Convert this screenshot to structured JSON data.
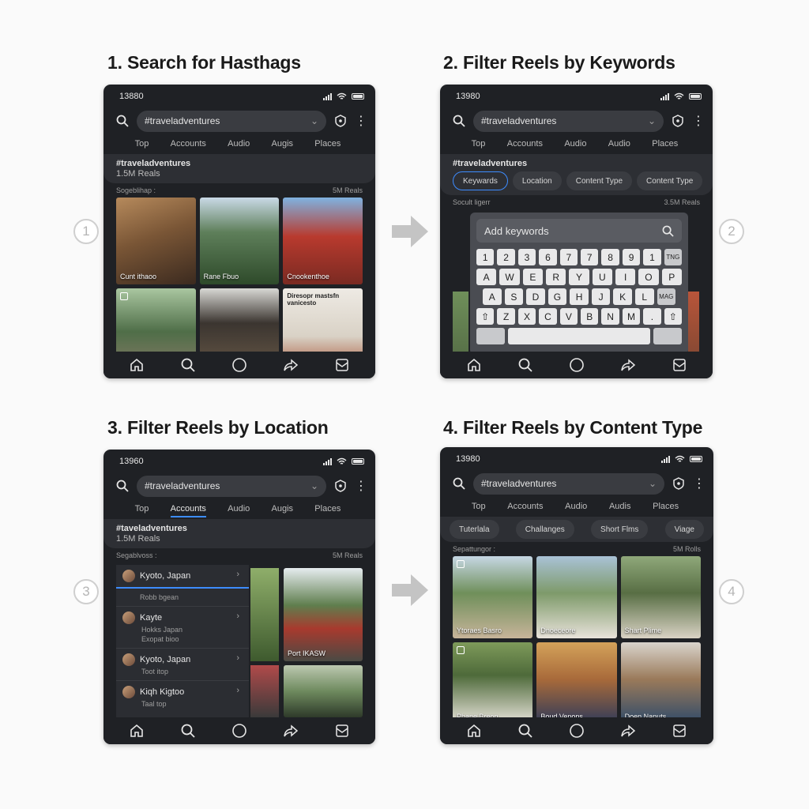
{
  "steps": [
    {
      "title": "1. Search for Hasthags",
      "num": "1"
    },
    {
      "title": "2. Filter Reels by Keywords",
      "num": "2"
    },
    {
      "title": "3. Filter Reels by Location",
      "num": "3"
    },
    {
      "title": "4. Filter Reels by Content Type",
      "num": "4"
    }
  ],
  "phone1": {
    "time": "13880",
    "search": "#traveladventures",
    "tabs": [
      "Top",
      "Accounts",
      "Audio",
      "Augis",
      "Places"
    ],
    "hash_title": "#traveladventures",
    "hash_sub": "1.5M Reals",
    "section_left": "Sogeblihap :",
    "section_right": "5M Reals",
    "thumbs": [
      "Cunt ithaoo",
      "Rane Fbuo",
      "Cnookenthoe",
      "",
      "",
      "Diresopr mastsfn vanicesto"
    ]
  },
  "phone2": {
    "time": "13980",
    "search": "#traveladventures",
    "tabs": [
      "Top",
      "Accounts",
      "Audio",
      "Audio",
      "Places"
    ],
    "hash_title": "#traveladventures",
    "chips": [
      "Keywards",
      "Location",
      "Content Type",
      "Content Type"
    ],
    "section_left": "Socult ligerr",
    "section_right": "3.5M Reals",
    "kw_placeholder": "Add keywords",
    "keyrow1": [
      "1",
      "2",
      "3",
      "6",
      "7",
      "7",
      "8",
      "9",
      "1",
      "TNG"
    ],
    "keyrow2": [
      "A",
      "W",
      "E",
      "R",
      "Y",
      "U",
      "I",
      "O",
      "P"
    ],
    "keyrow3": [
      "A",
      "S",
      "D",
      "G",
      "H",
      "J",
      "K",
      "L",
      "MAG"
    ],
    "keyrow4": [
      "⇧",
      "Z",
      "X",
      "C",
      "V",
      "B",
      "N",
      "M",
      ".",
      "⇧"
    ]
  },
  "phone3": {
    "time": "13960",
    "search": "#traveladventures",
    "tabs": [
      "Top",
      "Accounts",
      "Audio",
      "Augis",
      "Places"
    ],
    "hash_title": "#taveladventures",
    "hash_sub": "1.5M Reals",
    "section_left": "Segablvoss :",
    "section_right": "5M Reals",
    "locations": [
      {
        "name": "Kyoto, Japan",
        "sub": "Robb bgean"
      },
      {
        "name": "Kayte",
        "sub": "Hokks Japan",
        "sub2": "Exopat bioo"
      },
      {
        "name": "Kyoto, Japan",
        "sub": "Toot itop"
      },
      {
        "name": "Kiqh Kigtoo",
        "sub": "Taal top"
      }
    ],
    "thumb_caption": "Port IKASW"
  },
  "phone4": {
    "time": "13980",
    "search": "#traveladventures",
    "tabs": [
      "Top",
      "Accounts",
      "Audio",
      "Audis",
      "Places"
    ],
    "chips": [
      "Tuterlala",
      "Challanges",
      "Short Flms",
      "Viage"
    ],
    "section_left": "Sepattungor :",
    "section_right": "5M Rolls",
    "thumbs": [
      "Ytoraes Basro",
      "Dnoeceore",
      "Shart Plime",
      "Phane Breon",
      "Boud Venons",
      "Doen Nanuts"
    ]
  }
}
